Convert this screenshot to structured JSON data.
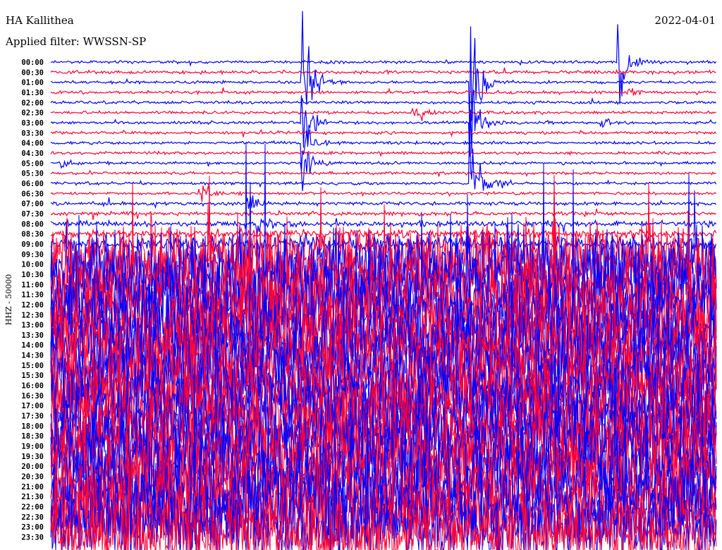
{
  "header": {
    "station": "HA Kallithea",
    "filter": "Applied filter: WWSSN-SP",
    "date": "2022-04-01"
  },
  "chart_data": {
    "type": "line",
    "title": "HA Kallithea",
    "subtitle": "Applied filter: WWSSN-SP",
    "date": "2022-04-01",
    "ylabel": "HHZ - 50000",
    "row_minutes": 30,
    "colors": [
      "#0000ff",
      "#ff0033"
    ],
    "row_labels": [
      "00:00",
      "00:30",
      "01:00",
      "01:30",
      "02:00",
      "02:30",
      "03:00",
      "03:30",
      "04:00",
      "04:30",
      "05:00",
      "05:30",
      "06:00",
      "06:30",
      "07:00",
      "07:30",
      "08:00",
      "08:30",
      "09:00",
      "09:30",
      "10:00",
      "10:30",
      "11:00",
      "11:30",
      "12:00",
      "12:30",
      "13:00",
      "13:30",
      "14:00",
      "14:30",
      "15:00",
      "15:30",
      "16:00",
      "16:30",
      "17:00",
      "17:30",
      "18:00",
      "18:30",
      "19:00",
      "19:30",
      "20:00",
      "20:30",
      "21:00",
      "21:30",
      "22:00",
      "22:30",
      "23:00",
      "23:30"
    ],
    "noise_level": [
      1,
      1.2,
      1,
      1,
      1,
      1,
      1,
      1,
      1,
      1,
      1,
      1,
      1,
      1,
      1.2,
      1.4,
      2,
      3,
      5,
      25,
      30,
      30,
      30,
      30,
      30,
      30,
      30,
      30,
      30,
      30,
      30,
      30,
      30,
      30,
      30,
      30,
      30,
      30,
      30,
      30,
      30,
      30,
      30,
      30,
      30,
      30,
      30,
      30
    ],
    "events": [
      {
        "row": 0,
        "minute": 25.6,
        "amplitude": 60
      },
      {
        "row": 2,
        "minute": 11.3,
        "amplitude": 90
      },
      {
        "row": 2,
        "minute": 18.9,
        "amplitude": 90
      },
      {
        "row": 3,
        "minute": 26.0,
        "amplitude": 8
      },
      {
        "row": 5,
        "minute": 16.3,
        "amplitude": 20
      },
      {
        "row": 6,
        "minute": 11.3,
        "amplitude": 60
      },
      {
        "row": 6,
        "minute": 18.9,
        "amplitude": 60
      },
      {
        "row": 6,
        "minute": 24.8,
        "amplitude": 8
      },
      {
        "row": 8,
        "minute": 11.3,
        "amplitude": 40
      },
      {
        "row": 10,
        "minute": 0.5,
        "amplitude": 5
      },
      {
        "row": 10,
        "minute": 11.3,
        "amplitude": 30
      },
      {
        "row": 12,
        "minute": 18.9,
        "amplitude": 90
      },
      {
        "row": 13,
        "minute": 6.7,
        "amplitude": 18
      },
      {
        "row": 14,
        "minute": 8.9,
        "amplitude": 12
      },
      {
        "row": 16,
        "minute": 9.3,
        "amplitude": 10
      }
    ]
  }
}
